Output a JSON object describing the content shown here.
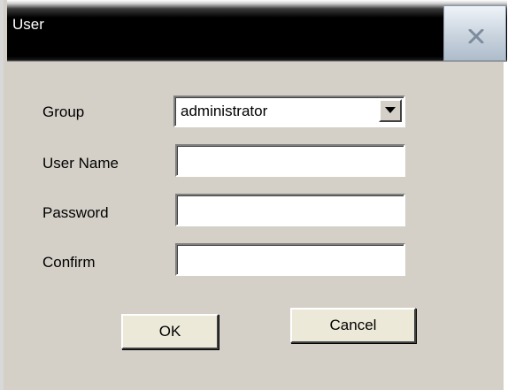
{
  "window": {
    "title": "User"
  },
  "form": {
    "group": {
      "label": "Group",
      "selected": "administrator"
    },
    "username": {
      "label": "User Name",
      "value": ""
    },
    "password": {
      "label": "Password",
      "value": ""
    },
    "confirm": {
      "label": "Confirm",
      "value": ""
    }
  },
  "buttons": {
    "ok": "OK",
    "cancel": "Cancel"
  },
  "icons": {
    "close": "close-icon",
    "dropdown": "chevron-down-icon"
  },
  "colors": {
    "titlebar": "#000000",
    "dialog_face": "#d4d0c8",
    "button_face": "#ece9d8"
  }
}
